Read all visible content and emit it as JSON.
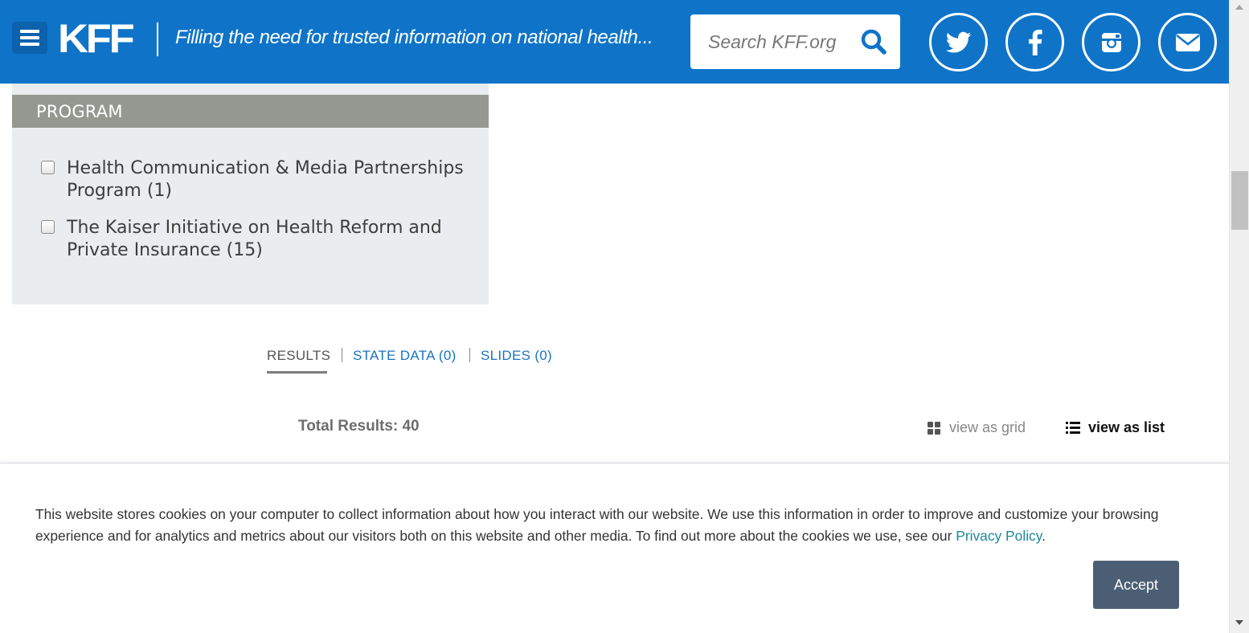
{
  "header": {
    "logo_text": "KFF",
    "tagline": "Filling the need for trusted information on national health...",
    "search_placeholder": "Search KFF.org",
    "social": [
      "twitter-icon",
      "facebook-icon",
      "instagram-icon",
      "email-icon"
    ],
    "brand_color": "#0f74c8"
  },
  "filter": {
    "title": "PROGRAM",
    "options": [
      {
        "label": "Health Communication & Media Partnerships Program (1)",
        "checked": false
      },
      {
        "label": "The Kaiser Initiative on Health Reform and Private Insurance (15)",
        "checked": false
      }
    ]
  },
  "tabs": [
    {
      "label": "RESULTS",
      "active": true
    },
    {
      "label": "STATE DATA (0)",
      "active": false
    },
    {
      "label": "SLIDES (0)",
      "active": false
    }
  ],
  "results": {
    "total_label": "Total Results: 40",
    "view_grid_label": "view as grid",
    "view_list_label": "view as list"
  },
  "cookie": {
    "text": "This website stores cookies on your computer to collect information about how you interact with our website. We use this information in order to improve and customize your browsing experience and for analytics and metrics about our visitors both on this website and other media. To find out more about the cookies we use, see our ",
    "link_text": "Privacy Policy",
    "text_end": ".",
    "accept_label": "Accept"
  }
}
